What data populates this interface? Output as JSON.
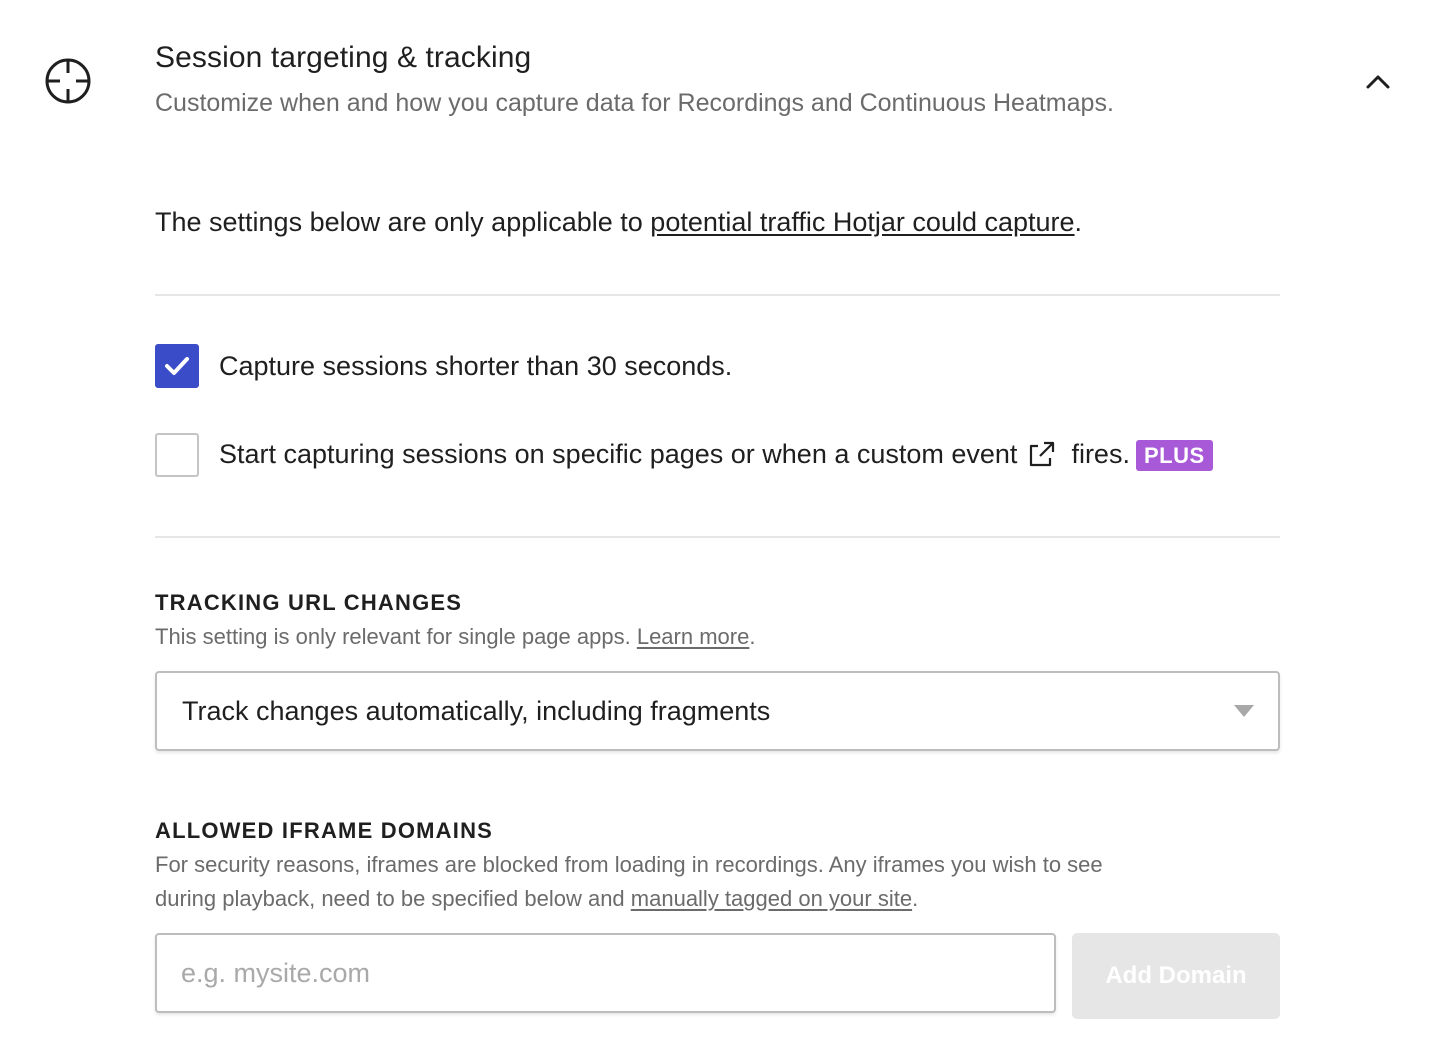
{
  "header": {
    "icon": "crosshair-icon",
    "title": "Session targeting & tracking",
    "subtitle": "Customize when and how you capture data for Recordings and Continuous Heatmaps.",
    "collapse_icon": "chevron-up-icon"
  },
  "intro": {
    "prefix": "The settings below are only applicable to ",
    "link": "potential traffic Hotjar could capture",
    "suffix": "."
  },
  "options": {
    "short_sessions": {
      "label": "Capture sessions shorter than 30 seconds.",
      "checked": true
    },
    "specific_pages": {
      "label_before": "Start capturing sessions on specific pages or when a custom event",
      "label_after": "fires.",
      "external_icon": "external-link-icon",
      "badge": "PLUS",
      "checked": false
    }
  },
  "tracking_url": {
    "title": "TRACKING URL CHANGES",
    "helper_prefix": "This setting is only relevant for single page apps. ",
    "helper_link": "Learn more",
    "helper_suffix": ".",
    "selected_value": "Track changes automatically, including fragments"
  },
  "iframe_domains": {
    "title": "ALLOWED IFRAME DOMAINS",
    "helper_line1": "For security reasons, iframes are blocked from loading in recordings. Any iframes you wish to see",
    "helper_line2_prefix": "during playback, need to be specified below and ",
    "helper_link": "manually tagged on your site",
    "helper_suffix": ".",
    "input_value": "",
    "input_placeholder": "e.g. mysite.com",
    "add_button": "Add Domain"
  },
  "colors": {
    "accent": "#3b4cc8",
    "badge": "#a859d8",
    "disabled_button": "#e6e6e6"
  }
}
